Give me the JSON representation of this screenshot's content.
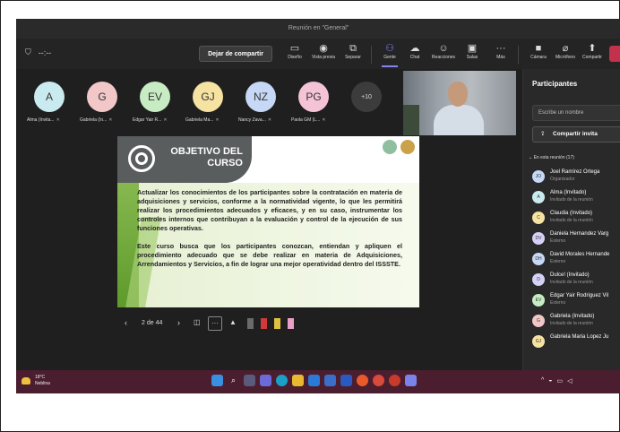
{
  "window": {
    "title": "Reunión en \"General\""
  },
  "toolbar": {
    "time": "--:--",
    "stop_share": "Dejar de compartir",
    "items": [
      {
        "label": "Diseño",
        "icon": "layout-icon"
      },
      {
        "label": "Vista previa",
        "icon": "preview-icon"
      },
      {
        "label": "Separar",
        "icon": "separate-icon"
      },
      {
        "label": "Gente",
        "icon": "people-icon"
      },
      {
        "label": "Chat",
        "icon": "chat-icon"
      },
      {
        "label": "Reacciones",
        "icon": "reactions-icon"
      },
      {
        "label": "Salas",
        "icon": "rooms-icon"
      },
      {
        "label": "Más",
        "icon": "more-icon"
      },
      {
        "label": "Cámara",
        "icon": "camera-icon"
      },
      {
        "label": "Micrófono",
        "icon": "microphone-icon"
      },
      {
        "label": "Compartir",
        "icon": "share-icon"
      }
    ]
  },
  "avatars": [
    {
      "initials": "A",
      "name": "Alma (Invita...",
      "color": "#c9ebf0"
    },
    {
      "initials": "G",
      "name": "Gabriela (In...",
      "color": "#f2c7c7"
    },
    {
      "initials": "EV",
      "name": "Edgar Yair R...",
      "color": "#c7ecc3"
    },
    {
      "initials": "GJ",
      "name": "Gabriela Ma...",
      "color": "#f6e2a1"
    },
    {
      "initials": "NZ",
      "name": "Nancy Zava...",
      "color": "#c6d8f5"
    },
    {
      "initials": "PG",
      "name": "Paola GM (L...",
      "color": "#f4c4d6"
    },
    {
      "initials": "+10",
      "name": "",
      "color": "#3c3c3c"
    }
  ],
  "slide": {
    "title_line1": "OBJETIVO DEL",
    "title_line2": "CURSO",
    "paragraph1": "Actualizar los conocimientos de los participantes sobre la contratación en materia de adquisiciones y servicios, conforme a la normatividad vigente, lo que les permitirá realizar los procedimientos adecuados y eficaces, y en su caso, instrumentar los controles internos que contribuyan a la evaluación y control de la ejecución de sus funciones operativas.",
    "paragraph2": "Este curso busca que los participantes conozcan, entiendan y apliquen el procedimiento adecuado que se debe realizar en materia de Adquisiciones, Arrendamientos y Servicios, a fin de lograr una mejor operatividad dentro del ISSSTE."
  },
  "controls": {
    "page": "2 de 44"
  },
  "taskbar": {
    "temp": "18°C",
    "weather": "Neblina"
  },
  "panel": {
    "title": "Participantes",
    "search_placeholder": "Escribe un nombre",
    "share_invite": "Compartir invita",
    "section": "En esta reunión (17)",
    "participants": [
      {
        "initials": "JO",
        "name": "Joel Ramírez Ortega",
        "role": "Organizador",
        "color": "#c6d8f5"
      },
      {
        "initials": "A",
        "name": "Alma (Invitado)",
        "role": "Invitado de la reunión",
        "color": "#c9ebf0"
      },
      {
        "initials": "C",
        "name": "Claudia (Invitado)",
        "role": "Invitado de la reunión",
        "color": "#f6e2a1"
      },
      {
        "initials": "DV",
        "name": "Daniela Hernandez Varg",
        "role": "Externo",
        "color": "#d5d0f5"
      },
      {
        "initials": "DH",
        "name": "David Morales Hernande",
        "role": "Externo",
        "color": "#c6d8f5"
      },
      {
        "initials": "D",
        "name": "Dulce! (Invitado)",
        "role": "Invitado de la reunión",
        "color": "#d5d0f5"
      },
      {
        "initials": "EV",
        "name": "Edgar Yair Rodriguez Vil",
        "role": "Externo",
        "color": "#c7ecc3"
      },
      {
        "initials": "G",
        "name": "Gabriela (Invitado)",
        "role": "Invitado de la reunión",
        "color": "#f2c7c7"
      },
      {
        "initials": "GJ",
        "name": "Gabriela Maria Lopez Ju",
        "role": "",
        "color": "#f6e2a1"
      }
    ]
  }
}
